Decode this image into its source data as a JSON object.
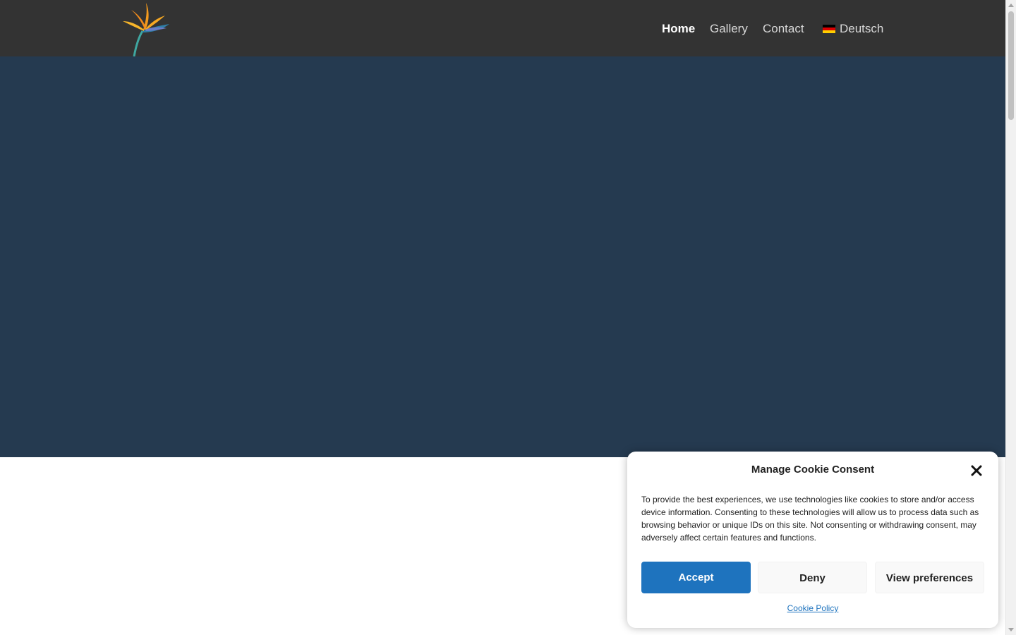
{
  "nav": {
    "home": "Home",
    "gallery": "Gallery",
    "contact": "Contact",
    "language": "Deutsch"
  },
  "icons": {
    "logo": "bird-of-paradise-flower-logo",
    "language_flag": "german-flag-icon",
    "close": "close-icon"
  },
  "colors": {
    "header_bg": "#333333",
    "hero_bg": "#253a50",
    "accent": "#1e73be"
  },
  "cookie": {
    "title": "Manage Cookie Consent",
    "text": "To provide the best experiences, we use technologies like cookies to store and/or access device information. Consenting to these technologies will allow us to process data such as browsing behavior or unique IDs on this site. Not consenting or withdrawing consent, may adversely affect certain features and functions.",
    "accept_label": "Accept",
    "deny_label": "Deny",
    "preferences_label": "View preferences",
    "policy_link": "Cookie Policy"
  }
}
